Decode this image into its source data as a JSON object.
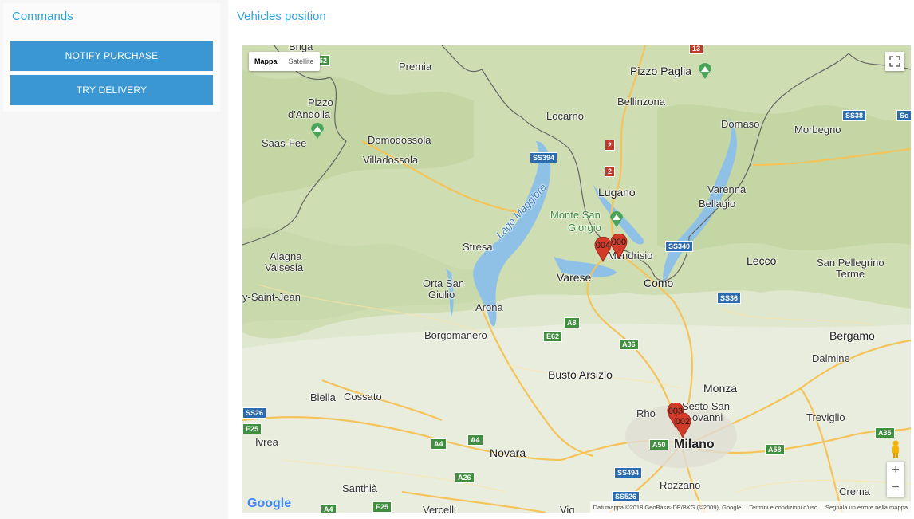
{
  "commands": {
    "title": "Commands",
    "buttons": [
      {
        "label": "NOTIFY PURCHASE"
      },
      {
        "label": "TRY DELIVERY"
      }
    ]
  },
  "map_panel": {
    "title": "Vehicles position",
    "map_type": {
      "active": "Mappa",
      "other": "Satellite"
    },
    "google_logo": "Google",
    "attribution": {
      "data": "Dati mappa ©2018 GeoBasis-DE/BKG (©2009), Google",
      "terms": "Termini e condizioni d'uso",
      "report": "Segnala un errore nella mappa"
    },
    "zoom": {
      "plus": "+",
      "minus": "−"
    },
    "places": {
      "briga": "Briga",
      "premia": "Premia",
      "pizzo_paglia": "Pizzo Paglia",
      "bellinzona": "Bellinzona",
      "locarno": "Locarno",
      "pizzo": "Pizzo",
      "andolla": "d'Andolla",
      "domaso": "Domaso",
      "morbegno": "Morbegno",
      "saas_fee": "Saas-Fee",
      "domodossola": "Domodossola",
      "villadossola": "Villadossola",
      "lugano": "Lugano",
      "varenna": "Varenna",
      "bellagio": "Bellagio",
      "lago_maggiore": "Lago Maggiore",
      "monte_san": "Monte San",
      "giorgio": "Giorgio",
      "stresa": "Stresa",
      "mendrisio": "Mendrisio",
      "alagna": "Alagna",
      "valsesia": "Valsesia",
      "lecco": "Lecco",
      "san_pellegrino": "San Pellegrino",
      "terme": "Terme",
      "varese": "Varese",
      "como": "Como",
      "orta_san": "Orta San",
      "giulio": "Giulio",
      "saint_jean": "y-Saint-Jean",
      "arona": "Arona",
      "borgomanero": "Borgomanero",
      "bergamo": "Bergamo",
      "dalmine": "Dalmine",
      "busto": "Busto Arsizio",
      "monza": "Monza",
      "biella": "Biella",
      "cossato": "Cossato",
      "sesto": "Sesto San",
      "giovanni": "Giovanni",
      "rho": "Rho",
      "treviglio": "Treviglio",
      "ivrea": "Ivrea",
      "milano": "Milano",
      "novara": "Novara",
      "rozzano": "Rozzano",
      "santhia": "Santhià",
      "crema": "Crema",
      "vercelli": "Vercelli",
      "vig": "Vig"
    },
    "shields": {
      "s13": "13",
      "s62": "62",
      "ss38": "SS38",
      "sc": "Sc",
      "ss394": "SS394",
      "s2a": "2",
      "s2b": "2",
      "ss340": "SS340",
      "ss36": "SS36",
      "a8": "A8",
      "e62": "E62",
      "a36": "A36",
      "ss26": "SS26",
      "e25": "E25",
      "a4a": "A4",
      "a4b": "A4",
      "a50": "A50",
      "a58": "A58",
      "a35": "A35",
      "a26": "A26",
      "ss494": "SS494",
      "ss526": "SS526",
      "a4c": "A4",
      "e25b": "E25"
    },
    "markers": [
      {
        "id": "004"
      },
      {
        "id": "000"
      },
      {
        "id": "003"
      },
      {
        "id": "002"
      }
    ]
  },
  "colors": {
    "accent": "#2ea3dc",
    "button": "#3a97d3",
    "marker": "#d23b2a"
  }
}
